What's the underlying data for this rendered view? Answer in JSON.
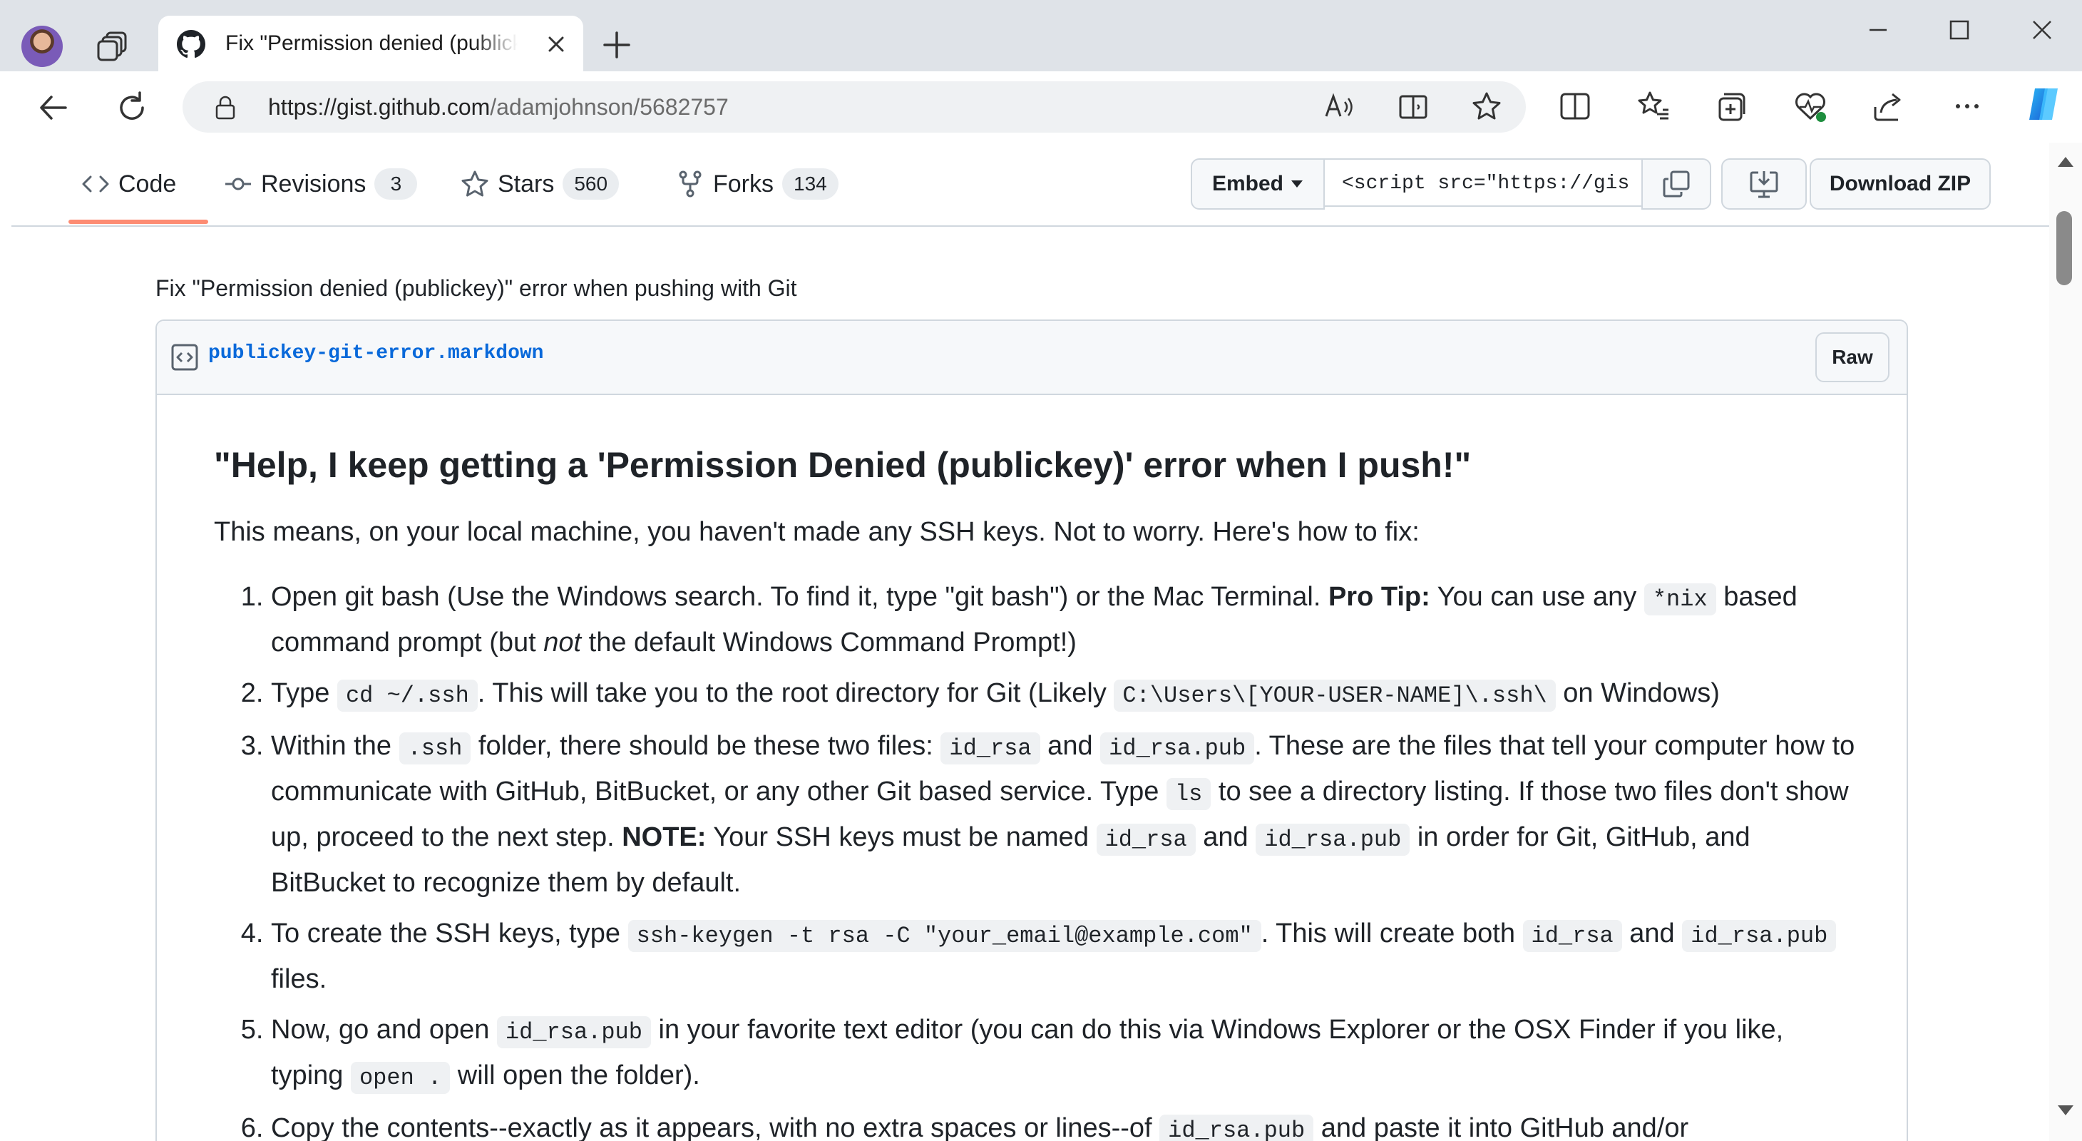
{
  "browser": {
    "tab_title": "Fix \"Permission denied (publickey",
    "url_host": "https://gist.github.com",
    "url_path": "/adamjohnson/5682757"
  },
  "gist_nav": {
    "code_label": "Code",
    "revisions_label": "Revisions",
    "revisions_count": "3",
    "stars_label": "Stars",
    "stars_count": "560",
    "forks_label": "Forks",
    "forks_count": "134",
    "embed_label": "Embed",
    "embed_value": "<script src=\"https://gis",
    "download_zip_label": "Download ZIP"
  },
  "gist": {
    "description": "Fix \"Permission denied (publickey)\" error when pushing with Git",
    "filename": "publickey-git-error.markdown",
    "raw_label": "Raw"
  },
  "content": {
    "heading": "\"Help, I keep getting a 'Permission Denied (publickey)' error when I push!\"",
    "intro": "This means, on your local machine, you haven't made any SSH keys. Not to worry. Here's how to fix:",
    "s1a": "Open git bash (Use the Windows search. To find it, type \"git bash\") or the Mac Terminal. ",
    "s1b": "Pro Tip:",
    "s1c": " You can use any ",
    "s1code": "*nix",
    "s1d": " based command prompt (but ",
    "s1e": "not",
    "s1f": " the default Windows Command Prompt!)",
    "s2a": "Type ",
    "s2code1": "cd ~/.ssh",
    "s2b": ". This will take you to the root directory for Git (Likely ",
    "s2code2": "C:\\Users\\[YOUR-USER-NAME]\\.ssh\\",
    "s2c": " on Windows)",
    "s3a": "Within the ",
    "s3code1": ".ssh",
    "s3b": " folder, there should be these two files: ",
    "s3code2": "id_rsa",
    "s3c": " and ",
    "s3code3": "id_rsa.pub",
    "s3d": ". These are the files that tell your computer how to communicate with GitHub, BitBucket, or any other Git based service. Type ",
    "s3code4": "ls",
    "s3e": " to see a directory listing. If those two files don't show up, proceed to the next step. ",
    "s3f": "NOTE:",
    "s3g": " Your SSH keys must be named ",
    "s3code5": "id_rsa",
    "s3h": " and ",
    "s3code6": "id_rsa.pub",
    "s3i": " in order for Git, GitHub, and BitBucket to recognize them by default.",
    "s4a": "To create the SSH keys, type ",
    "s4code1": "ssh-keygen -t rsa -C \"your_email@example.com\"",
    "s4b": ". This will create both ",
    "s4code2": "id_rsa",
    "s4c": " and ",
    "s4code3": "id_rsa.pub",
    "s4d": " files.",
    "s5a": "Now, go and open ",
    "s5code1": "id_rsa.pub",
    "s5b": " in your favorite text editor (you can do this via Windows Explorer or the OSX Finder if you like, typing ",
    "s5code2": "open .",
    "s5c": " will open the folder).",
    "s6a": "Copy the contents--exactly as it appears, with no extra spaces or lines--of ",
    "s6code": "id_rsa.pub",
    "s6b": " and paste it into GitHub and/or"
  }
}
